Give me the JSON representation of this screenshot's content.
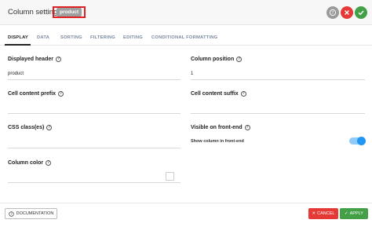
{
  "header": {
    "title": "Column settings:",
    "column_name": "product",
    "help_icon": "help-circle-icon",
    "close_icon": "close-icon",
    "confirm_icon": "check-icon"
  },
  "tabs": [
    {
      "label": "DISPLAY",
      "active": true
    },
    {
      "label": "DATA"
    },
    {
      "label": "SORTING"
    },
    {
      "label": "FILTERING"
    },
    {
      "label": "EDITING"
    },
    {
      "label": "CONDITIONAL FORMATTING"
    }
  ],
  "display": {
    "displayed_header": {
      "label": "Displayed header",
      "value": "product"
    },
    "column_position": {
      "label": "Column position",
      "value": "1"
    },
    "cell_prefix": {
      "label": "Cell content prefix",
      "value": ""
    },
    "cell_suffix": {
      "label": "Cell content suffix",
      "value": ""
    },
    "css_classes": {
      "label": "CSS class(es)",
      "value": ""
    },
    "visible_frontend": {
      "label": "Visible on front-end",
      "toggle_label": "Show column in front-end",
      "enabled": true
    },
    "column_color": {
      "label": "Column color",
      "value": ""
    }
  },
  "footer": {
    "documentation": "DOCUMENTATION",
    "cancel": "CANCEL",
    "apply": "APPLY"
  },
  "colors": {
    "danger": "#e53935",
    "success": "#43a047",
    "toggle": "#2196f3"
  }
}
